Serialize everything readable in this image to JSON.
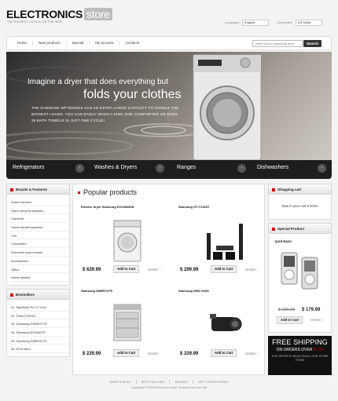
{
  "header": {
    "logo_main": "ELECTRONICS",
    "logo_store": "store",
    "tagline": "THE BIGGEST CHOICE ON THE WEB",
    "language_label": "Language:",
    "language_value": "English",
    "currencies_label": "Currencies:",
    "currencies_value": "US Dollar"
  },
  "nav": {
    "items": [
      "Home",
      "New products",
      "Special",
      "My account",
      "Contacts"
    ],
    "search_placeholder": "enter search keywords here",
    "search_button": "Search"
  },
  "banner": {
    "line1": "Imagine a dryer that does everything but",
    "line2": "folds your clothes",
    "body": "THE SAMSUNG WF7604SKS HAS AN EXTRA-LARGE CAPACITY TO HANDLE THE BIGGEST LOADS. YOU CAN EASILY WASH A KING SIZE COMFORTER OR EVEN 28 BATH TOWELS IN JUST ONE CYCLE!",
    "categories": [
      "Refrigerators",
      "Washes & Dryers",
      "Ranges",
      "Dishwashers"
    ]
  },
  "left": {
    "brands_title": "Brands & Features",
    "brands": [
      "Sound devices",
      "Home security systems",
      "Cameras",
      "Home theater systems",
      "TVs",
      "Computers",
      "Domestic sound studio",
      "Accessories",
      "Office",
      "Home related"
    ],
    "bestsellers_title": "Bestsellers",
    "bestsellers": [
      "01. MacBook Pro 17 inch",
      "02. TenerTVS216",
      "03. Samsung DMR57LFS",
      "04. Samsung E0106STE",
      "05. Samsung DMR57LFS",
      "06. iPod nano"
    ]
  },
  "main": {
    "title": "Popular products",
    "add_label": "Add to Cart",
    "details_label": "Details",
    "products": [
      {
        "name": "Electric dryer Samsung DV209AEW",
        "price": "$ 629.99"
      },
      {
        "name": "Samsung HT-TZ425T",
        "price": "$ 299.99"
      },
      {
        "name": "Samsung DMR57LFS",
        "price": "$ 229.99"
      },
      {
        "name": "Samsung HMX H106",
        "price": "$ 329.99"
      }
    ]
  },
  "right": {
    "cart_title": "Shopping cart",
    "cart_text": "Now in your cart 0 items",
    "special_title": "Special Product",
    "special_name": "Ipod Nano",
    "special_old": "$ 199.99",
    "special_new": "$ 179.99",
    "ship_title": "FREE SHIPPING",
    "ship_sub_prefix": "ON ORDERS OVER",
    "ship_sub_amount": "$ 150",
    "ship_note": "THIS OFFER IS VALID ON ALL OUR STORE ITEMS"
  },
  "footer": {
    "links": [
      "WHAT'S NEW?",
      "BEST SELLERS",
      "BRANDS",
      "GIFT CERTIFICATES"
    ],
    "copyright": "Copyright © 2009 Electronics store.   Powered by Zen Cart"
  }
}
